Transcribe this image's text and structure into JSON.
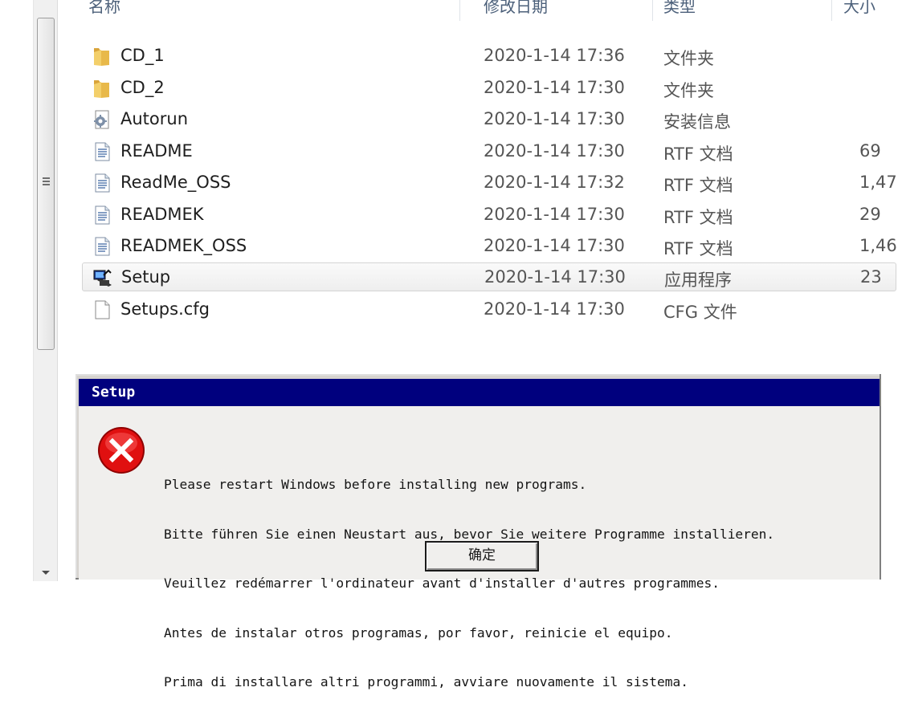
{
  "columns": {
    "name": "名称",
    "date": "修改日期",
    "type": "类型",
    "size": "大小"
  },
  "files": [
    {
      "name": "CD_1",
      "date": "2020-1-14 17:36",
      "type": "文件夹",
      "size": "",
      "icon": "folder-icon"
    },
    {
      "name": "CD_2",
      "date": "2020-1-14 17:30",
      "type": "文件夹",
      "size": "",
      "icon": "folder-icon"
    },
    {
      "name": "Autorun",
      "date": "2020-1-14 17:30",
      "type": "安装信息",
      "size": "",
      "icon": "setup-info-icon"
    },
    {
      "name": "README",
      "date": "2020-1-14 17:30",
      "type": "RTF 文档",
      "size": "69",
      "icon": "document-icon"
    },
    {
      "name": "ReadMe_OSS",
      "date": "2020-1-14 17:32",
      "type": "RTF 文档",
      "size": "1,47",
      "icon": "document-icon"
    },
    {
      "name": "READMEK",
      "date": "2020-1-14 17:30",
      "type": "RTF 文档",
      "size": "29",
      "icon": "document-icon"
    },
    {
      "name": "READMEK_OSS",
      "date": "2020-1-14 17:30",
      "type": "RTF 文档",
      "size": "1,46",
      "icon": "document-icon"
    },
    {
      "name": "Setup",
      "date": "2020-1-14 17:30",
      "type": "应用程序",
      "size": "23",
      "icon": "setup-app-icon",
      "selected": true
    },
    {
      "name": "Setups.cfg",
      "date": "2020-1-14 17:30",
      "type": "CFG 文件",
      "size": "",
      "icon": "blank-file-icon"
    }
  ],
  "dialog": {
    "title": "Setup",
    "icon": "error-icon",
    "message_lines": [
      "Please restart Windows before installing new programs.",
      "Bitte führen Sie einen Neustart aus, bevor Sie weitere Programme installieren.",
      "Veuillez redémarrer l'ordinateur avant d'installer d'autres programmes.",
      "Antes de instalar otros programas, por favor, reinicie el equipo.",
      "Prima di installare altri programmi, avviare nuovamente il sistema."
    ],
    "ok_label": "确定"
  },
  "colors": {
    "titlebar": "#00007e",
    "dialog_bg": "#f0efed",
    "header_text": "#4c607a",
    "error_red": "#e01010"
  }
}
